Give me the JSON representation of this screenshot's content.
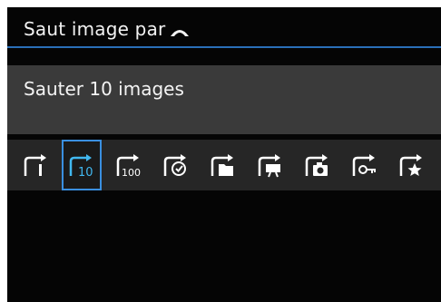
{
  "menu": {
    "title": "Saut image par",
    "title_icon": "dial-icon",
    "current_value": "Sauter 10 images"
  },
  "jump_options": [
    {
      "name": "jump-1-image",
      "label": "1",
      "selected": false
    },
    {
      "name": "jump-10-images",
      "label": "10",
      "selected": true
    },
    {
      "name": "jump-100-images",
      "label": "100",
      "selected": false
    },
    {
      "name": "jump-by-date",
      "label": "",
      "selected": false
    },
    {
      "name": "jump-by-folder",
      "label": "",
      "selected": false
    },
    {
      "name": "jump-movies",
      "label": "",
      "selected": false
    },
    {
      "name": "jump-stills",
      "label": "",
      "selected": false
    },
    {
      "name": "jump-protected",
      "label": "",
      "selected": false
    },
    {
      "name": "jump-rating",
      "label": "",
      "selected": false
    }
  ],
  "colors": {
    "accent": "#3a8fe0",
    "selected_icon": "#41b8f0",
    "rule": "#2a6fb8",
    "value_bg": "#3a3a3a",
    "row_bg": "#262626"
  }
}
